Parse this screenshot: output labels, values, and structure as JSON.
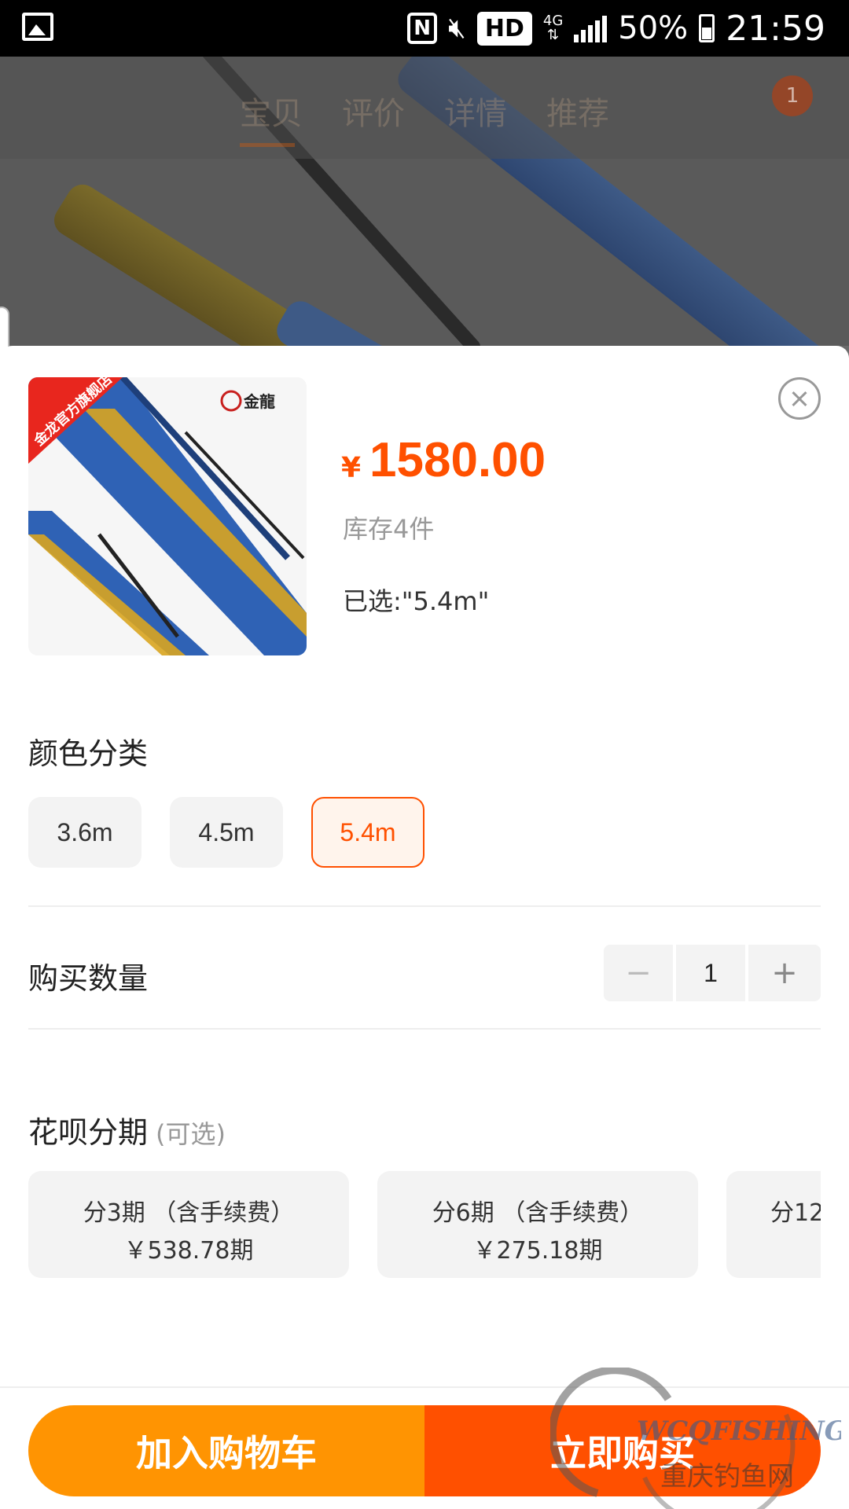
{
  "status_bar": {
    "nfc": "N",
    "hd": "HD",
    "network": "4G",
    "battery": "50%",
    "battery_level": 0.5,
    "time": "21:59",
    "icons": [
      "gallery-icon",
      "nfc-icon",
      "mute-icon",
      "signal-icon",
      "battery-icon"
    ]
  },
  "background": {
    "tabs": [
      "宝贝",
      "评价",
      "详情",
      "推荐"
    ],
    "cart_badge": "1"
  },
  "product": {
    "brand": "金龍",
    "store_ribbon": "金龙官方旗舰店",
    "currency": "¥",
    "price": "1580.00",
    "stock": "库存4件",
    "selected": "已选:\"5.4m\""
  },
  "color_section": {
    "title": "颜色分类",
    "options": [
      {
        "label": "3.6m",
        "selected": false
      },
      {
        "label": "4.5m",
        "selected": false
      },
      {
        "label": "5.4m",
        "selected": true
      }
    ]
  },
  "quantity_section": {
    "title": "购买数量",
    "minus": "−",
    "value": "1",
    "plus": "+"
  },
  "installment_section": {
    "title": "花呗分期",
    "hint": "(可选)",
    "options": [
      {
        "line1": "分3期 （含手续费）",
        "line2": "￥538.78期"
      },
      {
        "line1": "分6期 （含手续费）",
        "line2": "￥275.18期"
      },
      {
        "line1": "分12",
        "line2": ""
      }
    ]
  },
  "actions": {
    "add_to_cart": "加入购物车",
    "buy_now": "立即购买"
  },
  "watermark": {
    "text": "WCQFISHING",
    "subtitle": "重庆钓鱼网"
  },
  "colors": {
    "accent": "#ff5000",
    "cart_button": "#ff9402"
  }
}
